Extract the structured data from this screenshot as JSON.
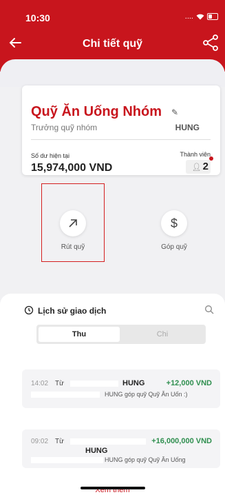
{
  "status": {
    "time": "10:30",
    "signal": "....",
    "wifi": "wifi-icon"
  },
  "header": {
    "title": "Chi tiết quỹ",
    "back_icon": "back-arrow-icon",
    "share_icon": "share-icon"
  },
  "fund": {
    "name": "Quỹ Ăn Uống Nhóm",
    "role_label": "Trưởng quỹ nhóm",
    "leader": "HUNG",
    "balance_label": "Số dư hiện tại",
    "balance_value": "15,974,000 VND",
    "members_label": "Thành viên",
    "members_count": "2"
  },
  "actions": {
    "withdraw": {
      "icon": "↗",
      "label": "Rút quỹ"
    },
    "contribute": {
      "icon": "$",
      "label": "Góp quỹ"
    }
  },
  "history": {
    "title": "Lịch sử giao dịch",
    "tabs": {
      "thu": "Thu",
      "chi": "Chi"
    },
    "transactions": [
      {
        "time": "14:02",
        "from_label": "Từ",
        "name": "HUNG",
        "amount": "+12,000 VND",
        "desc": "HUNG góp quỹ Quỹ Ăn Uốn :)"
      },
      {
        "time": "09:02",
        "from_label": "Từ",
        "name": "HUNG",
        "amount": "+16,000,000 VND",
        "desc": "HUNG góp quỹ Quỹ Ăn Uống"
      }
    ],
    "more": "Xem thêm"
  },
  "colors": {
    "brand": "#c8151d",
    "income": "#2f8f4f"
  }
}
